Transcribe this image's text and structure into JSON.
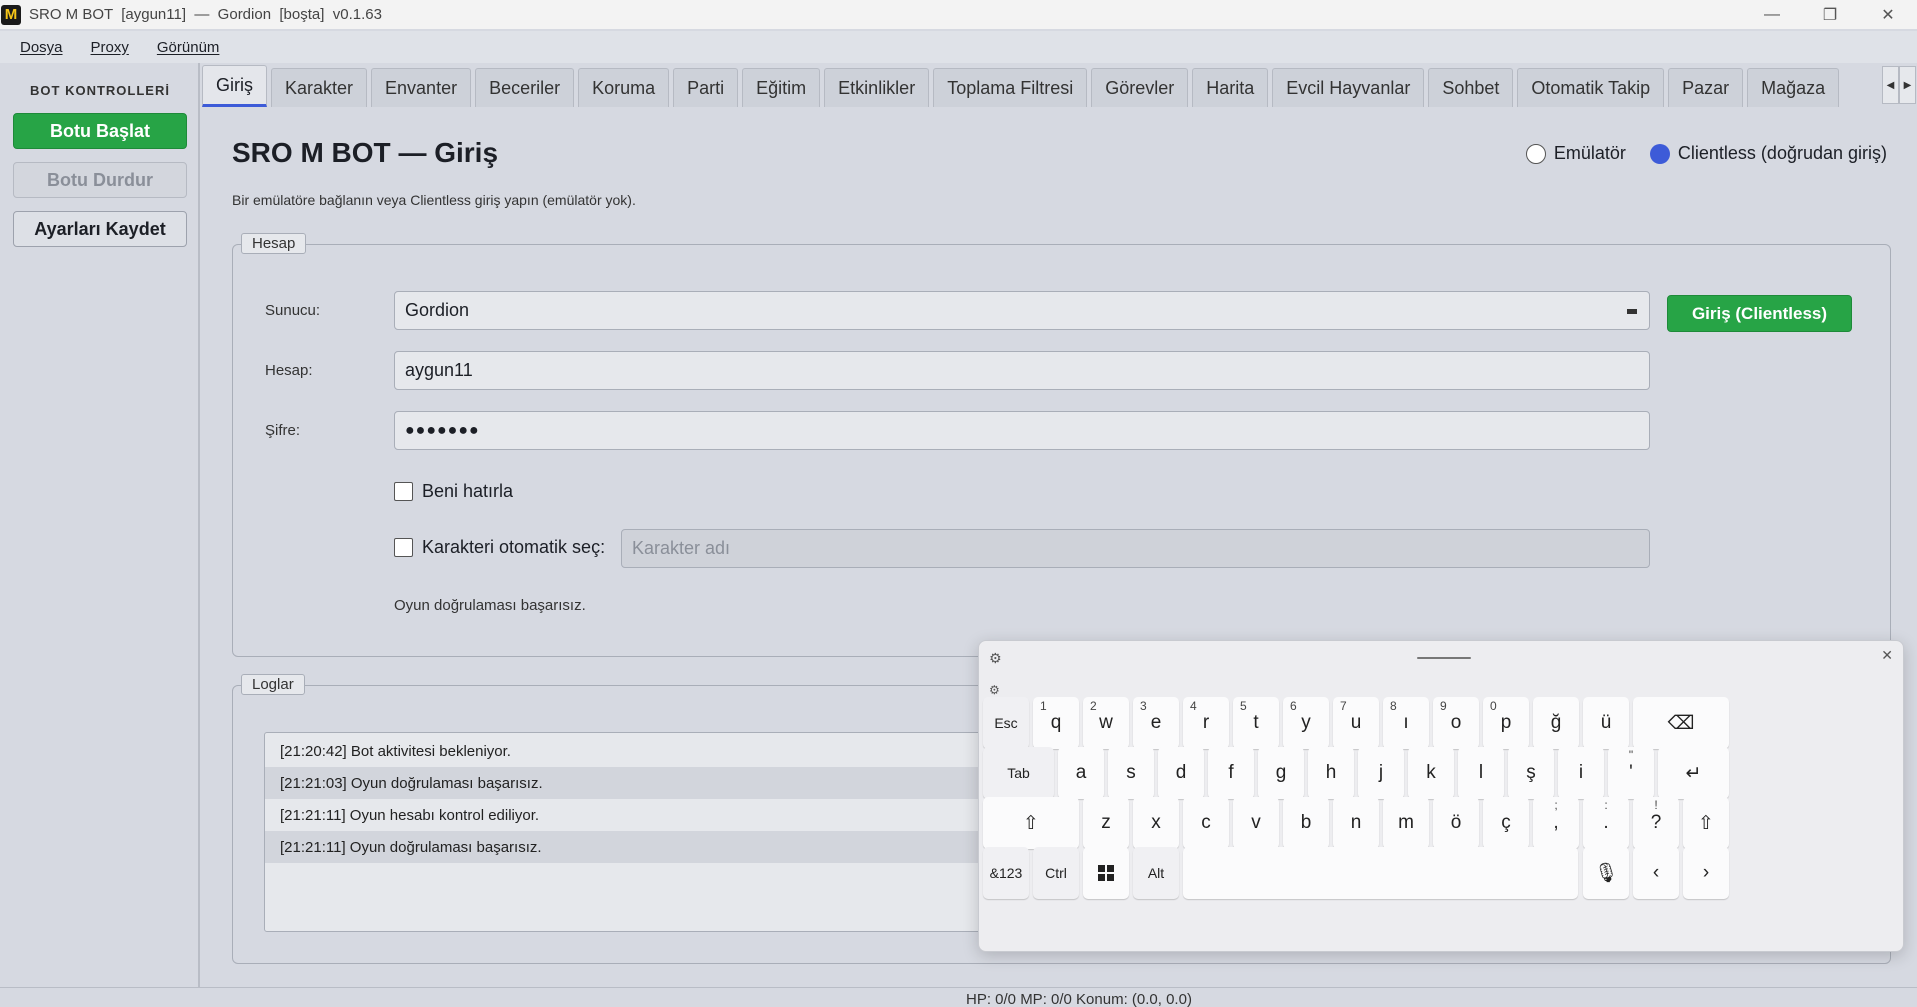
{
  "window": {
    "logo_letter": "M",
    "title": "SRO M BOT  [aygun11]  —  Gordion  [boşta]  v0.1.63",
    "minimize": "—",
    "maximize": "❐",
    "close": "✕"
  },
  "menu": [
    "Dosya",
    "Proxy",
    "Görünüm"
  ],
  "sidebar": {
    "title": "BOT KONTROLLERİ",
    "start": "Botu Başlat",
    "stop": "Botu Durdur",
    "save": "Ayarları Kaydet"
  },
  "tabs": [
    "Giriş",
    "Karakter",
    "Envanter",
    "Beceriler",
    "Koruma",
    "Parti",
    "Eğitim",
    "Etkinlikler",
    "Toplama Filtresi",
    "Görevler",
    "Harita",
    "Evcil Hayvanlar",
    "Sohbet",
    "Otomatik Takip",
    "Pazar",
    "Mağaza"
  ],
  "page": {
    "title": "SRO M BOT — Giriş",
    "subtitle": "Bir emülatöre bağlanın veya Clientless giriş yapın (emülatör yok).",
    "mode_emulator": "Emülatör",
    "mode_clientless": "Clientless (doğrudan giriş)",
    "selected_mode": "clientless"
  },
  "account": {
    "legend": "Hesap",
    "server_label": "Sunucu:",
    "server_value": "Gordion",
    "account_label": "Hesap:",
    "account_value": "aygun11",
    "password_label": "Şifre:",
    "password_value": "●●●●●●●",
    "login_button": "Giriş (Clientless)",
    "remember_me": "Beni hatırla",
    "auto_char": "Karakteri otomatik seç:",
    "char_placeholder": "Karakter adı",
    "status": "Oyun doğrulaması başarısız."
  },
  "logs": {
    "legend": "Loglar",
    "entries": [
      "[21:20:42] Bot aktivitesi bekleniyor.",
      "[21:21:03] Oyun doğrulaması başarısız.",
      "[21:21:11] Oyun hesabı kontrol ediliyor.",
      "[21:21:11] Oyun doğrulaması başarısız."
    ]
  },
  "statusbar": "HP: 0/0  MP: 0/0  Konum: (0.0, 0.0)",
  "keyboard": {
    "row1": [
      {
        "k": "Esc"
      },
      {
        "k": "q",
        "s": "1"
      },
      {
        "k": "w",
        "s": "2"
      },
      {
        "k": "e",
        "s": "3"
      },
      {
        "k": "r",
        "s": "4"
      },
      {
        "k": "t",
        "s": "5"
      },
      {
        "k": "y",
        "s": "6"
      },
      {
        "k": "u",
        "s": "7"
      },
      {
        "k": "ı",
        "s": "8"
      },
      {
        "k": "o",
        "s": "9"
      },
      {
        "k": "p",
        "s": "0"
      },
      {
        "k": "ğ"
      },
      {
        "k": "ü"
      },
      {
        "k": "⌫"
      }
    ],
    "row2": [
      {
        "k": "Tab"
      },
      {
        "k": "a"
      },
      {
        "k": "s"
      },
      {
        "k": "d"
      },
      {
        "k": "f"
      },
      {
        "k": "g"
      },
      {
        "k": "h"
      },
      {
        "k": "j"
      },
      {
        "k": "k"
      },
      {
        "k": "l"
      },
      {
        "k": "ş"
      },
      {
        "k": "i"
      },
      {
        "k": "'",
        "s": "\""
      },
      {
        "k": "↵"
      }
    ],
    "row3": [
      {
        "k": "⇧"
      },
      {
        "k": "z"
      },
      {
        "k": "x"
      },
      {
        "k": "c"
      },
      {
        "k": "v"
      },
      {
        "k": "b"
      },
      {
        "k": "n"
      },
      {
        "k": "m"
      },
      {
        "k": "ö"
      },
      {
        "k": "ç"
      },
      {
        "k": ",",
        "s": ";"
      },
      {
        "k": ".",
        "s": ":"
      },
      {
        "k": "?",
        "s": "!"
      },
      {
        "k": "⇧"
      }
    ],
    "row4": [
      {
        "k": "&123"
      },
      {
        "k": "Ctrl"
      },
      {
        "k": "win"
      },
      {
        "k": "Alt"
      },
      {
        "k": ""
      },
      {
        "k": "🎙"
      },
      {
        "k": "‹"
      },
      {
        "k": "›"
      }
    ],
    "gear": "⚙",
    "close": "✕"
  }
}
